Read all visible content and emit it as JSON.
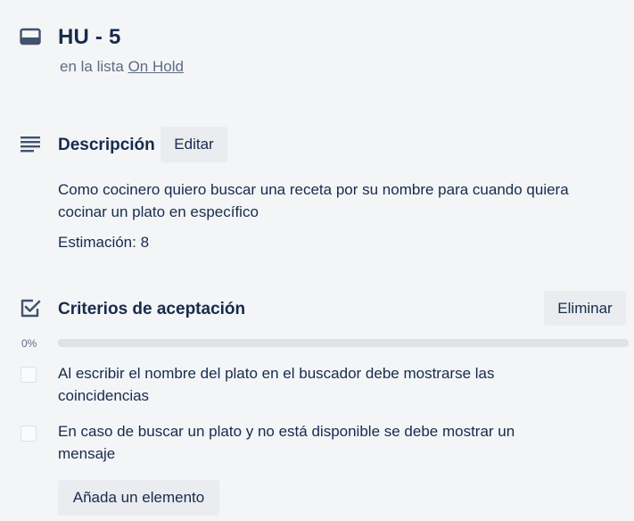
{
  "card": {
    "title": "HU - 5",
    "list_prefix": "en la lista",
    "list_name": "On Hold"
  },
  "description": {
    "title": "Descripción",
    "edit_label": "Editar",
    "text": "Como cocinero quiero buscar una receta por su nombre para cuando quiera cocinar un plato en específico",
    "estimate": "Estimación: 8"
  },
  "checklist": {
    "title": "Criterios de aceptación",
    "delete_label": "Eliminar",
    "progress_label": "0%",
    "progress": 0,
    "items": [
      {
        "text": "Al escribir el nombre del plato en el buscador debe mostrarse las coincidencias",
        "checked": false
      },
      {
        "text": "En caso de buscar un plato y no está disponible se debe mostrar un mensaje",
        "checked": false
      }
    ],
    "add_label": "Añada un elemento"
  },
  "icons": {
    "card": "card-icon",
    "description": "description-lines-icon",
    "checklist": "checklist-check-icon"
  },
  "colors": {
    "background": "#f4f5f7",
    "text": "#172b4d",
    "muted": "#5e6c84",
    "button": "#ebecf0",
    "progress_track": "#dfe1e6"
  }
}
